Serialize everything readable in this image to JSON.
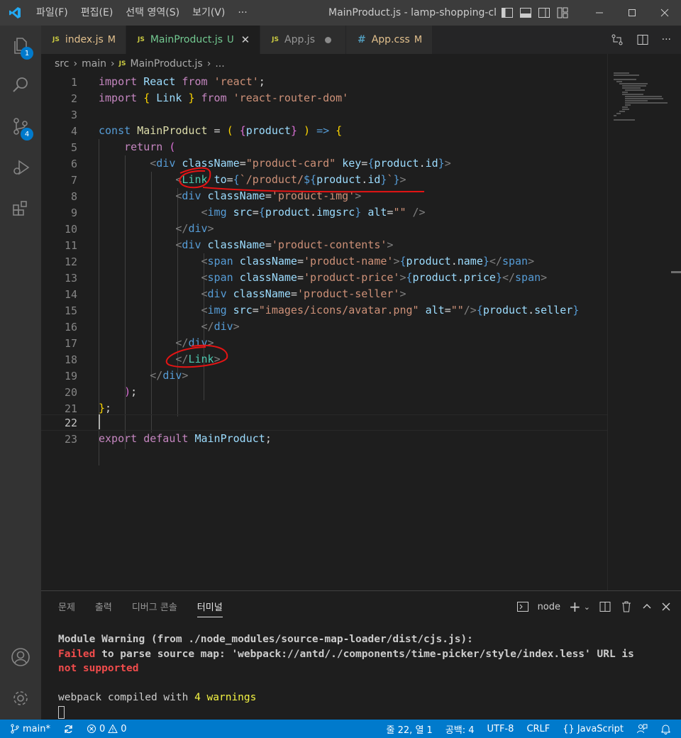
{
  "titlebar": {
    "menus": [
      "파일(F)",
      "편집(E)",
      "선택 영역(S)",
      "보기(V)"
    ],
    "more": "···",
    "window_title": "MainProduct.js - lamp-shopping-cli...",
    "controls": [
      "minimize",
      "maximize",
      "close"
    ]
  },
  "activity_bar": {
    "items": [
      {
        "name": "explorer",
        "badge": "1"
      },
      {
        "name": "search",
        "badge": null
      },
      {
        "name": "source-control",
        "badge": "4"
      },
      {
        "name": "run-and-debug",
        "badge": null
      },
      {
        "name": "extensions",
        "badge": null
      }
    ],
    "bottom": [
      "accounts",
      "manage"
    ]
  },
  "tabs": [
    {
      "icon": "JS",
      "label": "index.js",
      "status": "M",
      "active": false
    },
    {
      "icon": "JS",
      "label": "MainProduct.js",
      "status": "U",
      "active": true
    },
    {
      "icon": "JS",
      "label": "App.js",
      "status": "",
      "active": false,
      "dirty": true
    },
    {
      "icon": "#",
      "label": "App.css",
      "status": "M",
      "active": false
    }
  ],
  "breadcrumb": {
    "parts": [
      "src",
      "main"
    ],
    "file_icon": "JS",
    "file": "MainProduct.js",
    "tail": "..."
  },
  "editor": {
    "line_numbers": [
      "1",
      "2",
      "3",
      "4",
      "5",
      "6",
      "7",
      "8",
      "9",
      "10",
      "11",
      "12",
      "13",
      "14",
      "15",
      "16",
      "17",
      "18",
      "19",
      "20",
      "21",
      "22",
      "23"
    ],
    "current_line": 22
  },
  "panel": {
    "tabs": [
      "문제",
      "출력",
      "디버그 콘솔",
      "터미널"
    ],
    "active_tab": "터미널",
    "terminal_name": "node",
    "terminal": {
      "line1": "Module Warning (from ./node_modules/source-map-loader/dist/cjs.js):",
      "line2_failed": "Failed",
      "line2_rest": " to parse source map: 'webpack://antd/./components/time-picker/style/index.less' URL is",
      "line3": "not supported",
      "line4_pre": "webpack compiled with ",
      "line4_count": "4 warnings"
    }
  },
  "statusbar": {
    "branch": "main*",
    "errors": "0",
    "warnings": "0",
    "position": "줄 22, 열 1",
    "indent": "공백: 4",
    "encoding": "UTF-8",
    "eol": "CRLF",
    "language": "JavaScript"
  },
  "colors": {
    "accent": "#007acc",
    "annotation": "#e51414"
  }
}
